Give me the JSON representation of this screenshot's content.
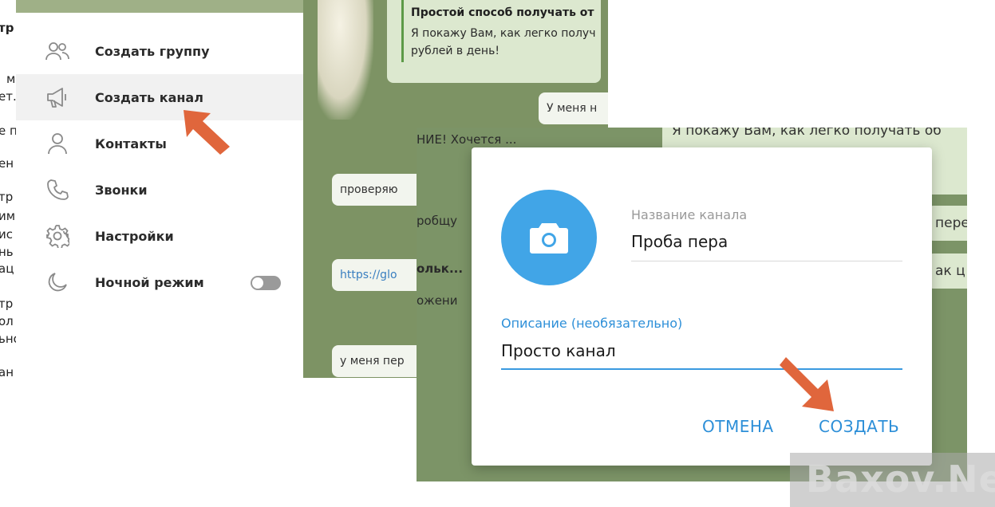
{
  "left_fragments": [
    "тр",
    "ет.",
    "м",
    "е п",
    "ен",
    "тр",
    "им",
    "ис",
    "нь",
    "ац",
    "тр",
    "ол",
    "ьнo",
    "ан"
  ],
  "menu": {
    "items": [
      {
        "id": "create-group",
        "label": "Создать группу",
        "icon": "group-icon"
      },
      {
        "id": "create-channel",
        "label": "Создать канал",
        "icon": "megaphone-icon"
      },
      {
        "id": "contacts",
        "label": "Контакты",
        "icon": "person-icon"
      },
      {
        "id": "calls",
        "label": "Звонки",
        "icon": "phone-icon"
      },
      {
        "id": "settings",
        "label": "Настройки",
        "icon": "gear-icon"
      },
      {
        "id": "night-mode",
        "label": "Ночной режим",
        "icon": "moon-icon"
      }
    ],
    "night_mode_on": false
  },
  "chat_back": {
    "quote_link": "",
    "quote_title": "Простой способ получать от",
    "quote_line2": "Я покажу Вам, как легко получ",
    "quote_line3": "рублей в день!",
    "bubble_top": "У меня н",
    "preview_text": "НИЕ!  Хочется ...",
    "bubble_check": "проверяю",
    "frag_share": "робщу",
    "bubble_link": "https://glo",
    "frag_only": "ольк...",
    "frag_lozh": "ожени",
    "bubble_bottom": "у меня пер"
  },
  "chat_front": {
    "line_top": "Я покажу Вам, как легко получать об",
    "frag_right1": "пере",
    "frag_right2": "ак ц"
  },
  "dialog": {
    "name_label": "Название канала",
    "name_value": "Проба пера",
    "desc_label": "Описание (необязательно)",
    "desc_value": "Просто канал",
    "cancel_label": "ОТМЕНА",
    "create_label": "СОЗДАТЬ"
  },
  "watermark": {
    "text": "Baxov.Net"
  },
  "colors": {
    "accent": "#2d8fd8",
    "avatar": "#41a5e7",
    "arrow": "#e0663c"
  }
}
